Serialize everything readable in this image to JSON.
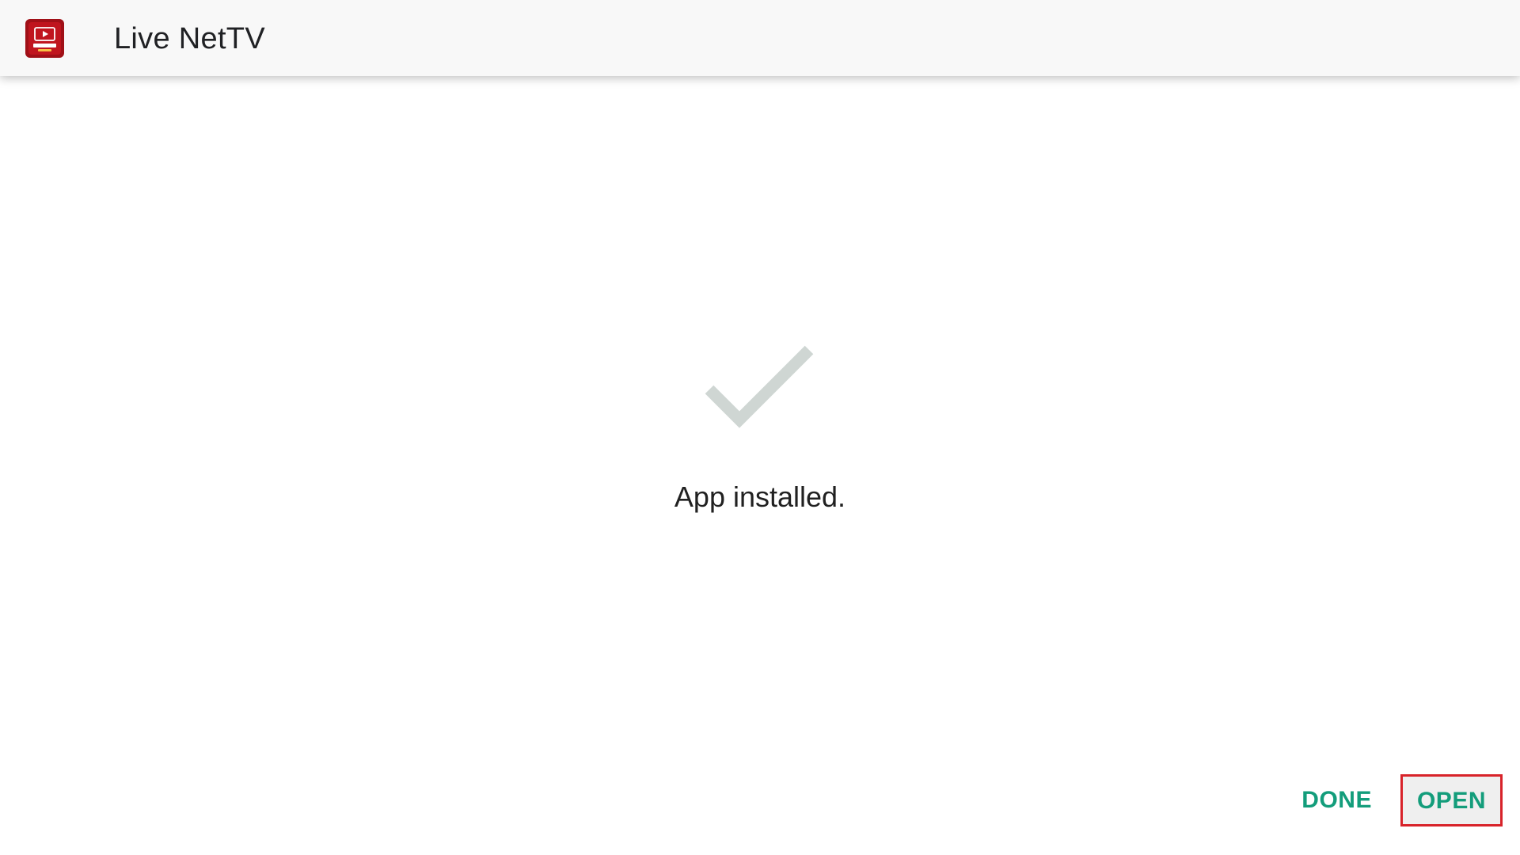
{
  "header": {
    "title": "Live NetTV",
    "app_icon": "live-nettv-icon"
  },
  "status": {
    "message": "App installed.",
    "icon": "checkmark-icon"
  },
  "actions": {
    "done_label": "DONE",
    "open_label": "OPEN"
  },
  "colors": {
    "accent": "#139d7b",
    "focus_outline": "#d8232a",
    "check": "#cfd6d3"
  }
}
